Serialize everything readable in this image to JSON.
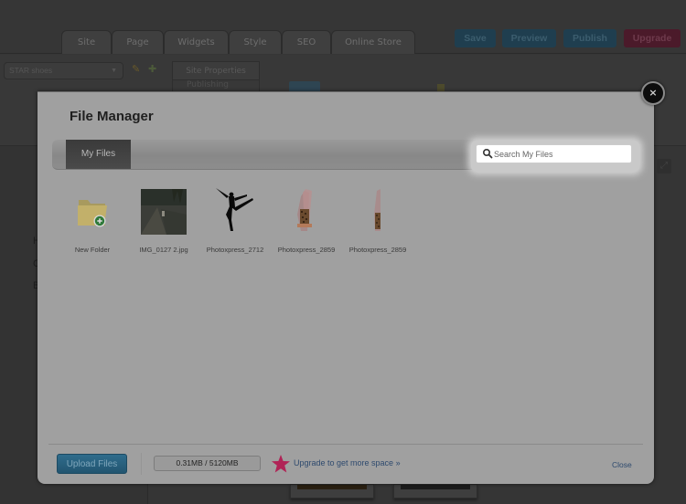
{
  "editor": {
    "tabs": [
      {
        "label": "Site"
      },
      {
        "label": "Page"
      },
      {
        "label": "Widgets"
      },
      {
        "label": "Style"
      },
      {
        "label": "SEO"
      },
      {
        "label": "Online Store"
      }
    ],
    "buttons": {
      "save": "Save",
      "preview": "Preview",
      "publish": "Publish",
      "upgrade": "Upgrade"
    },
    "site_select": "STAR shoes",
    "subtabs": {
      "site_properties": "Site Properties",
      "publishing": "Publishing"
    },
    "sidebar_letters": [
      "H",
      "C",
      "B"
    ]
  },
  "modal": {
    "title": "File Manager",
    "tab_label": "My Files",
    "search_placeholder": "Search My Files",
    "search_value": "",
    "close_x": "×",
    "files": [
      {
        "name": "New Folder",
        "type": "new-folder"
      },
      {
        "name": "IMG_0127 2.jpg",
        "type": "image-photo"
      },
      {
        "name": "Photoxpress_2712",
        "type": "image-dancer"
      },
      {
        "name": "Photoxpress_2859",
        "type": "image-shoes-1"
      },
      {
        "name": "Photoxpress_2859",
        "type": "image-shoes-2"
      }
    ],
    "footer": {
      "upload_label": "Upload Files",
      "usage_text": "0.31MB / 5120MB",
      "used_mb": 0.31,
      "total_mb": 5120,
      "upgrade_text": "Upgrade to get more space »",
      "close_label": "Close"
    },
    "colors": {
      "upload_button": "#2f6c8c",
      "upgrade_star": "#c0245e",
      "link": "#2e4a6e"
    }
  }
}
